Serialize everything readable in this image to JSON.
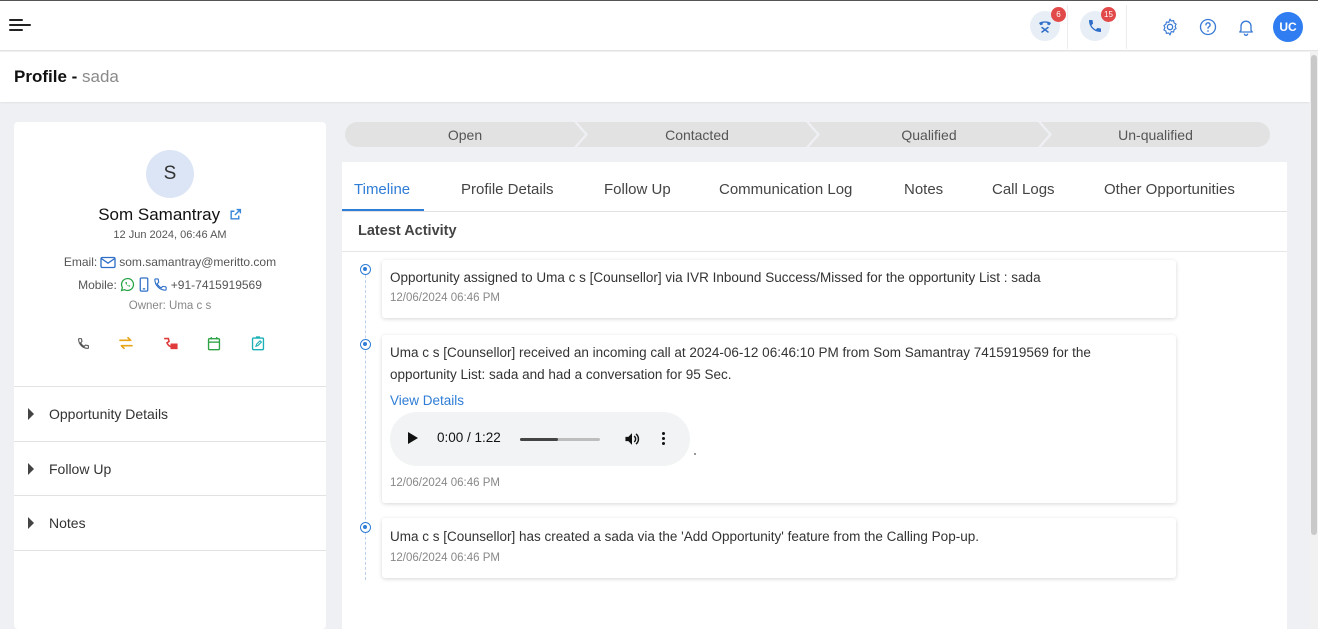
{
  "header": {
    "notifications": [
      {
        "icon": "call-transfer-icon",
        "badge": "6"
      },
      {
        "icon": "phone-call-icon",
        "badge": "15"
      }
    ],
    "icons": [
      "settings-gear-icon",
      "help-question-icon",
      "bell-icon"
    ],
    "user_initials": "UC"
  },
  "profile": {
    "title": "Profile - ",
    "subtitle": "sada"
  },
  "contact": {
    "avatar_letter": "S",
    "name": "Som Samantray",
    "created": "12 Jun 2024, 06:46 AM",
    "email_label": "Email:",
    "email": "som.samantray@meritto.com",
    "mobile_label": "Mobile:",
    "mobile": "+91-7415919569",
    "owner": "Owner: Uma c s"
  },
  "accordion": [
    {
      "label": "Opportunity Details"
    },
    {
      "label": "Follow Up"
    },
    {
      "label": "Notes"
    }
  ],
  "stages": [
    "Open",
    "Contacted",
    "Qualified",
    "Un-qualified"
  ],
  "tabs": [
    {
      "label": "Timeline"
    },
    {
      "label": "Profile Details"
    },
    {
      "label": "Follow Up"
    },
    {
      "label": "Communication Log"
    },
    {
      "label": "Notes"
    },
    {
      "label": "Call Logs"
    },
    {
      "label": "Other Opportunities"
    }
  ],
  "timeline": {
    "heading": "Latest Activity",
    "entries": [
      {
        "text": "Opportunity assigned to Uma c s [Counsellor] via IVR Inbound Success/Missed for the opportunity List : sada",
        "time": "12/06/2024 06:46 PM"
      },
      {
        "text": "Uma c s [Counsellor] received an incoming call at 2024-06-12 06:46:10 PM from Som Samantray 7415919569 for the opportunity List: sada and had a conversation for 95 Sec.",
        "link": "View Details",
        "audio_time": "0:00 / 1:22",
        "audio_progress": 0.47,
        "time": "12/06/2024 06:46 PM"
      },
      {
        "text": "Uma c s [Counsellor] has created a sada via the 'Add Opportunity' feature from the Calling Pop-up.",
        "time": "12/06/2024 06:46 PM"
      }
    ]
  },
  "colors": {
    "accent": "#2f7dd6",
    "badge": "#e24a4a",
    "whatsapp": "#25a244"
  }
}
